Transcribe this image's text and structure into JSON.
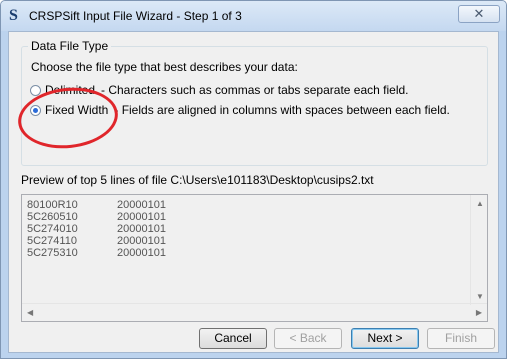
{
  "window": {
    "title": "CRSPSift Input File Wizard - Step 1 of 3",
    "app_icon_glyph": "S",
    "close_glyph": "✕"
  },
  "file_type_group": {
    "legend": "Data File Type",
    "instruction": "Choose the file type that best describes your data:",
    "options": [
      {
        "label": "Delimited",
        "description": "- Characters such as commas or tabs separate each field.",
        "checked": false
      },
      {
        "label": "Fixed Width",
        "description": "- Fields are aligned in columns with spaces between each field.",
        "checked": true
      }
    ]
  },
  "preview": {
    "label": "Preview of top 5 lines of file C:\\Users\\e101183\\Desktop\\cusips2.txt",
    "lines": [
      {
        "c1": "80100R10",
        "c2": "20000101"
      },
      {
        "c1": "5C260510",
        "c2": "20000101"
      },
      {
        "c1": "5C274010",
        "c2": "20000101"
      },
      {
        "c1": "5C274110",
        "c2": "20000101"
      },
      {
        "c1": "5C275310",
        "c2": "20000101"
      }
    ]
  },
  "buttons": {
    "cancel": "Cancel",
    "back": "< Back",
    "next": "Next >",
    "finish": "Finish"
  },
  "colors": {
    "highlight_ellipse": "#e0262b",
    "radio_selected": "#2a6bd8"
  }
}
